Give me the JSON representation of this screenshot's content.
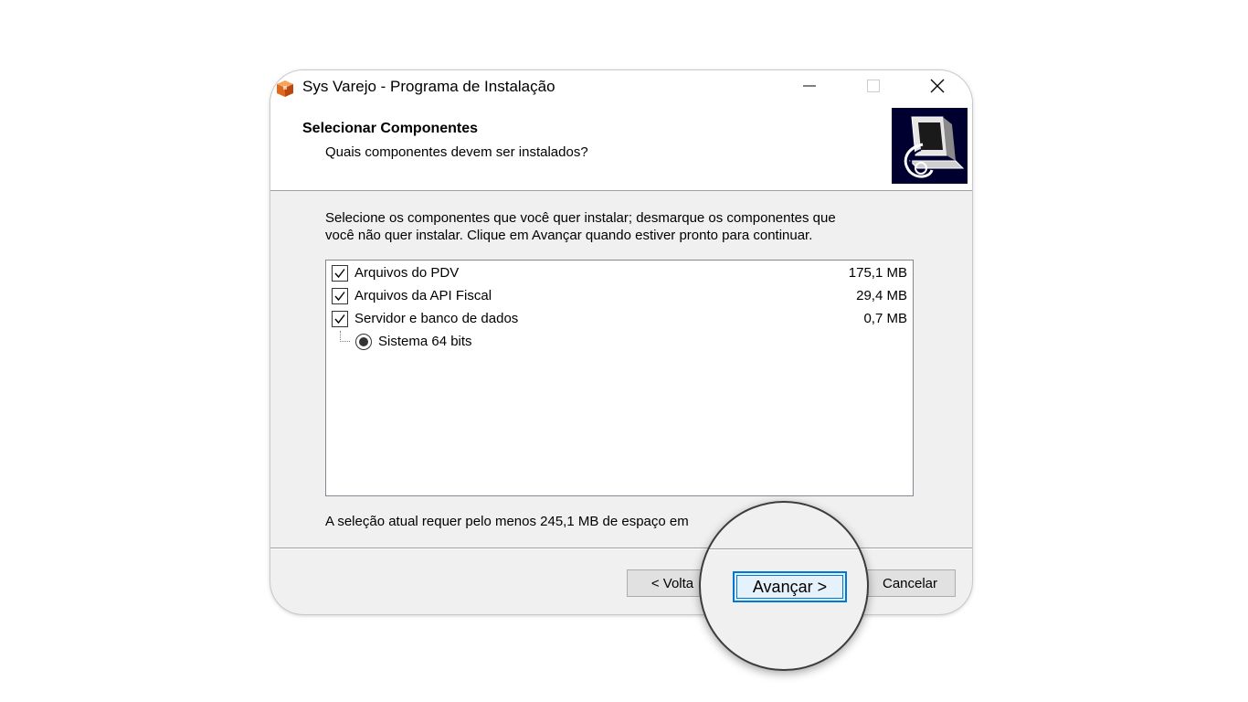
{
  "window": {
    "title": "Sys Varejo - Programa de Instalação"
  },
  "header": {
    "title": "Selecionar Componentes",
    "subtitle": "Quais componentes devem ser instalados?"
  },
  "instructions": {
    "line1": "Selecione os componentes que você quer instalar; desmarque os componentes que",
    "line2": "você não quer instalar. Clique em Avançar quando estiver pronto para continuar."
  },
  "components": [
    {
      "label": "Arquivos do PDV",
      "size": "175,1 MB",
      "checked": true
    },
    {
      "label": "Arquivos da API Fiscal",
      "size": "29,4 MB",
      "checked": true
    },
    {
      "label": "Servidor e banco de dados",
      "size": "0,7 MB",
      "checked": true
    }
  ],
  "sub_option": {
    "label": "Sistema 64 bits",
    "selected": true
  },
  "space_text": "A seleção atual requer pelo menos 245,1 MB de espaço em",
  "buttons": {
    "back": "< Volta",
    "next": "Avançar >",
    "cancel": "Cancelar"
  },
  "colors": {
    "accent": "#0078d7",
    "window_bg": "#f0f0f0",
    "header_image_bg": "#000030"
  }
}
